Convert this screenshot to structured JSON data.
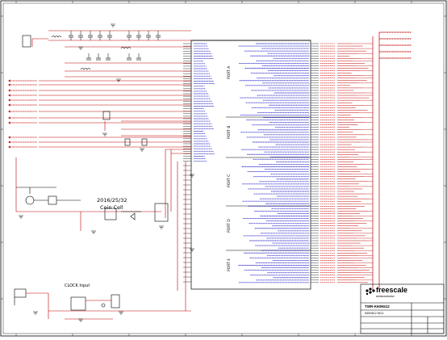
{
  "schematic": {
    "coin_cell_label": "2016/25/32",
    "coin_cell_sub": "Coin Cell",
    "clock_label": "CLOCK Input",
    "port_labels": [
      "PORT A",
      "PORT B",
      "PORT C",
      "PORT D",
      "PORT E"
    ],
    "title_block": {
      "company": "freescale",
      "company_sub": "semiconductor",
      "board": "TWR-K60N512",
      "sheet_name": "K60N512 MCU"
    },
    "colors": {
      "wire": "#c00000",
      "net_blue": "#0000c0",
      "border": "#000000"
    }
  }
}
